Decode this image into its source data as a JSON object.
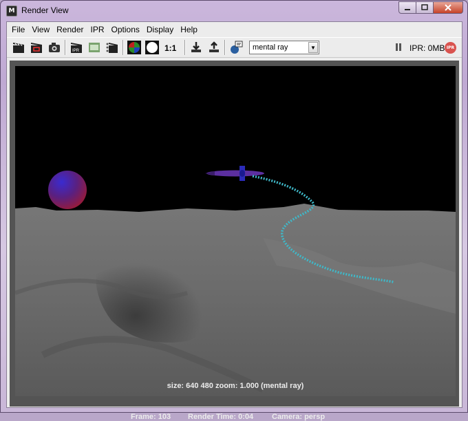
{
  "window": {
    "title": "Render View"
  },
  "menu": [
    "File",
    "View",
    "Render",
    "IPR",
    "Options",
    "Display",
    "Help"
  ],
  "toolbar": {
    "ratio_label": "1:1",
    "renderer": "mental ray",
    "ipr_memory": "IPR: 0MB",
    "ipr_badge": "IPR",
    "ipr_button_label": "IPR"
  },
  "render_info": {
    "size_line": "size:  640  480 zoom: 1.000      (mental ray)",
    "frame_label": "Frame: 103",
    "render_time": "Render Time: 0:04",
    "camera": "Camera: persp"
  },
  "icons": {
    "colors": {
      "accent_red": "#d9534f",
      "trail": "#3fb8c8",
      "planet_red": "#b02040",
      "planet_blue": "#3030c0"
    }
  }
}
